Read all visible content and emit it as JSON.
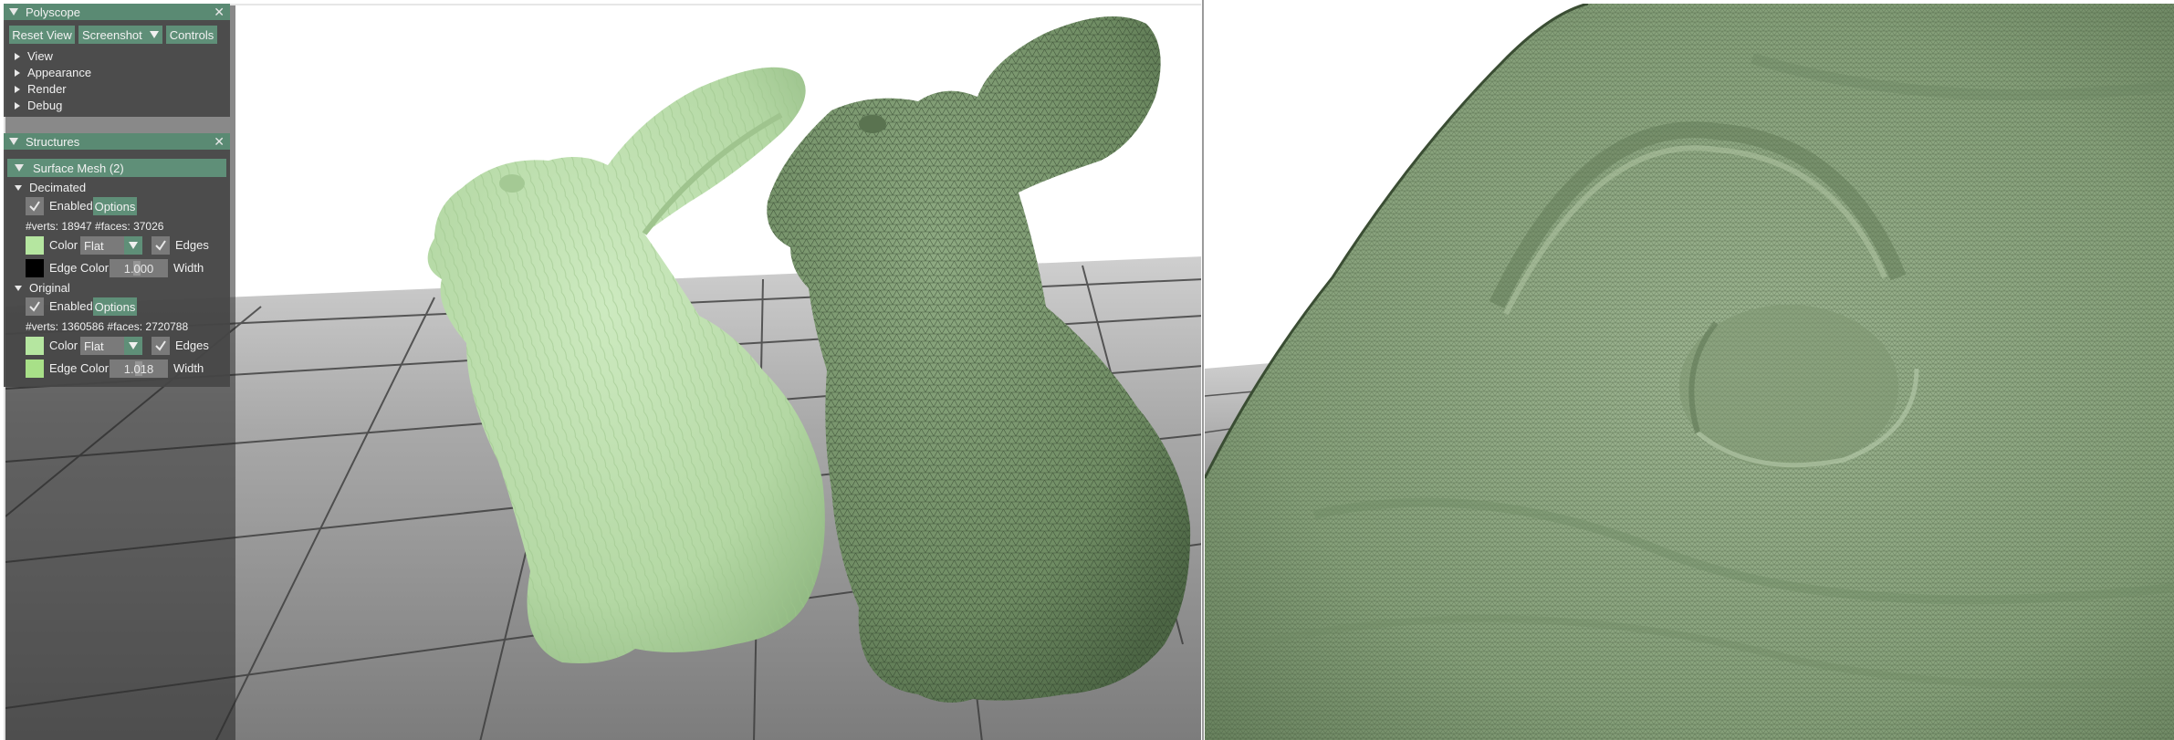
{
  "polyscope_panel": {
    "title": "Polyscope",
    "buttons": {
      "reset_view": "Reset View",
      "screenshot": "Screenshot",
      "controls": "Controls"
    },
    "tree": [
      "View",
      "Appearance",
      "Render",
      "Debug"
    ]
  },
  "structures_panel": {
    "title": "Structures",
    "group_header": "Surface Mesh (2)",
    "meshes": [
      {
        "name": "Decimated",
        "enabled_label": "Enabled",
        "options_label": "Options",
        "stats": "#verts: 18947  #faces: 37026",
        "color_label": "Color",
        "color": "#b5e6a0",
        "shading": "Flat",
        "edges_label": "Edges",
        "edge_color_label": "Edge Color",
        "edge_color": "#000000",
        "width_value": "1.000",
        "width_label": "Width"
      },
      {
        "name": "Original",
        "enabled_label": "Enabled",
        "options_label": "Options",
        "stats": "#verts: 1360586  #faces: 2720788",
        "color_label": "Color",
        "color": "#b5e6a0",
        "shading": "Flat",
        "edges_label": "Edges",
        "edge_color_label": "Edge Color",
        "edge_color": "#a8e088",
        "width_value": "1.018",
        "width_label": "Width"
      }
    ]
  },
  "colors": {
    "accent": "#5f8f78",
    "panel_bg": "#464646",
    "bunny_smooth": "#b9dcaa",
    "bunny_mesh": "#6f8c63"
  }
}
